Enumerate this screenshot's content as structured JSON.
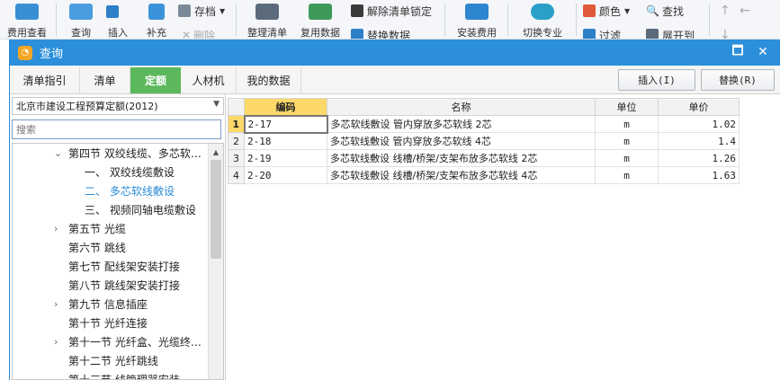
{
  "ribbon": {
    "fee_view": "费用查看",
    "query": "查询",
    "insert": "插入",
    "supplement": "补充",
    "delete": "删除",
    "archive": "存档",
    "organize_list": "整理清单",
    "reuse_data": "复用数据",
    "unlock_list": "解除清单锁定",
    "replace_data": "替换数据",
    "install_fee": "安装费用",
    "switch_major": "切换专业",
    "color": "颜色",
    "find": "查找",
    "filter": "过滤",
    "expand": "展开到"
  },
  "dialog": {
    "title": "查询",
    "minimize_glyph": "🗖",
    "close_glyph": "✕",
    "tabs": [
      {
        "label": "清单指引"
      },
      {
        "label": "清单"
      },
      {
        "label": "定额"
      },
      {
        "label": "人材机"
      },
      {
        "label": "我的数据"
      }
    ],
    "insert_btn": "插入(I)",
    "replace_btn": "替换(R)"
  },
  "left": {
    "quota_library": "北京市建设工程预算定额(2012)",
    "search_placeholder": "搜索",
    "tree": [
      {
        "toggle": "⌄",
        "label": "第四节 双绞线缆、多芯软…"
      },
      {
        "toggle": "",
        "label": "一、 双绞线缆敷设"
      },
      {
        "toggle": "",
        "label": "二、 多芯软线敷设"
      },
      {
        "toggle": "",
        "label": "三、 视频同轴电缆敷设"
      },
      {
        "toggle": "›",
        "label": "第五节 光缆"
      },
      {
        "toggle": "",
        "label": "第六节 跳线"
      },
      {
        "toggle": "",
        "label": "第七节 配线架安装打接"
      },
      {
        "toggle": "",
        "label": "第八节 跳线架安装打接"
      },
      {
        "toggle": "›",
        "label": "第九节 信息插座"
      },
      {
        "toggle": "",
        "label": "第十节 光纤连接"
      },
      {
        "toggle": "›",
        "label": "第十一节 光纤盒、光缆终…"
      },
      {
        "toggle": "",
        "label": "第十二节 光纤跳线"
      },
      {
        "toggle": "",
        "label": "第十三节 线管理器安装"
      }
    ]
  },
  "grid": {
    "headers": {
      "code": "编码",
      "name": "名称",
      "unit": "单位",
      "price": "单价"
    },
    "rows": [
      {
        "num": "1",
        "code": "2-17",
        "name": "多芯软线敷设 管内穿放多芯软线 2芯",
        "unit": "m",
        "price": "1.02"
      },
      {
        "num": "2",
        "code": "2-18",
        "name": "多芯软线敷设 管内穿放多芯软线 4芯",
        "unit": "m",
        "price": "1.4"
      },
      {
        "num": "3",
        "code": "2-19",
        "name": "多芯软线敷设 线槽/桥架/支架布放多芯软线 2芯",
        "unit": "m",
        "price": "1.26"
      },
      {
        "num": "4",
        "code": "2-20",
        "name": "多芯软线敷设 线槽/桥架/支架布放多芯软线 4芯",
        "unit": "m",
        "price": "1.63"
      }
    ]
  },
  "colors": {
    "title_bar": "#2b8fdc",
    "active_tab": "#5cb85c",
    "header_highlight": "#fcd86a",
    "selected_tree": "#2b8bd6"
  }
}
